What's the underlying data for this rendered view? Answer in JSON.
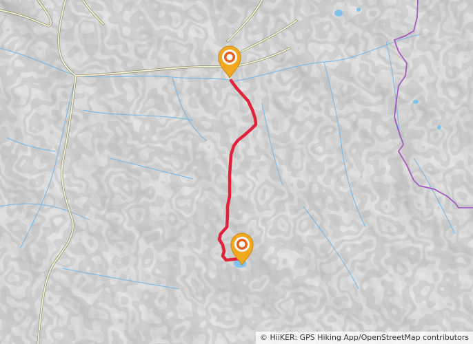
{
  "map": {
    "attribution": "© HiiKER: GPS Hiking App/OpenStreetMap contributors",
    "colors": {
      "terrain_base": "#e8e8e8",
      "contour": "#b5b5b5",
      "shadow": "#9a9a9a",
      "stream": "#6fb3e6",
      "lake": "#7fc2ec",
      "road": "#f4f2d6",
      "road_casing": "#8e8c70",
      "boundary": "#a35bc2",
      "route": "#e0223a",
      "marker_outer": "#f0a820",
      "marker_ring": "#ffffff",
      "marker_core": "#e8601c"
    },
    "markers": [
      {
        "name": "start-marker",
        "icon": "map-pin-icon"
      },
      {
        "name": "end-marker",
        "icon": "map-pin-icon"
      }
    ]
  }
}
